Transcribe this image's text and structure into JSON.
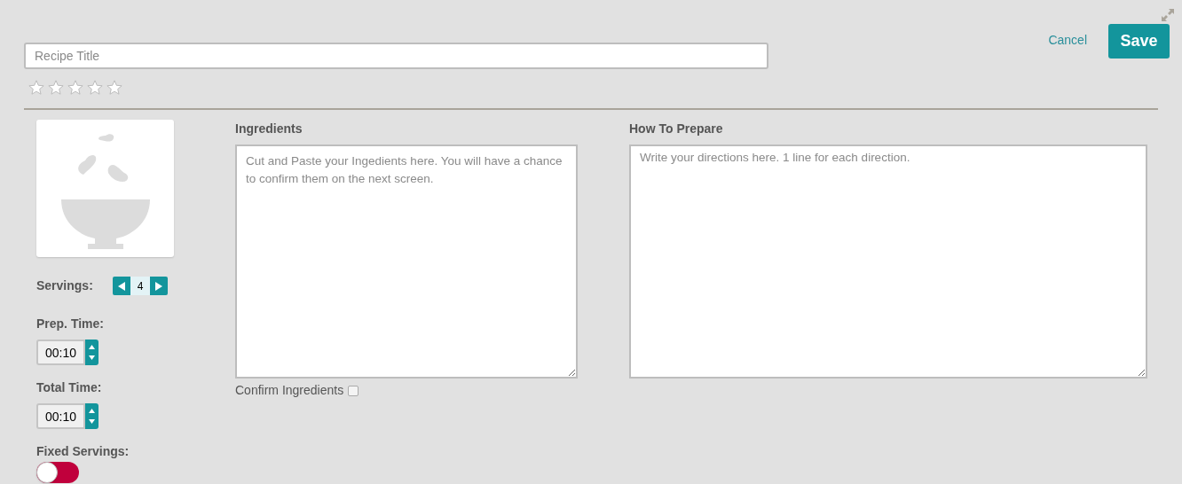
{
  "header": {
    "title_placeholder": "Recipe Title",
    "stars": 0,
    "cancel": "Cancel",
    "save": "Save"
  },
  "servings": {
    "label": "Servings:",
    "value": "4"
  },
  "prep_time": {
    "label": "Prep. Time:",
    "value": "00:10"
  },
  "total_time": {
    "label": "Total Time:",
    "value": "00:10"
  },
  "fixed_servings": {
    "label": "Fixed Servings:",
    "on": false
  },
  "ingredients": {
    "label": "Ingredients",
    "placeholder": "Cut and Paste your Ingedients here. You will have a chance to confirm them on the next screen.",
    "confirm_label": "Confirm Ingredients",
    "checked": false
  },
  "directions": {
    "label": "How To Prepare",
    "placeholder": "Write your directions here. 1 line for each direction."
  }
}
